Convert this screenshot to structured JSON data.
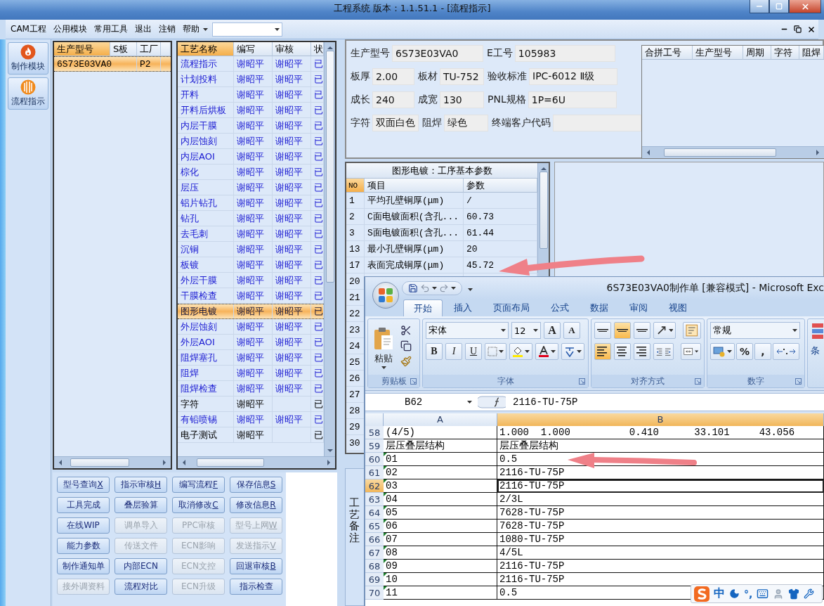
{
  "window": {
    "title": "工程系统   版本：1.1.51.1 - [流程指示]"
  },
  "menu": [
    "CAM工程",
    "公用模块",
    "常用工具",
    "退出",
    "注销",
    "帮助"
  ],
  "sidebar": [
    {
      "label": "制作模块",
      "kind": "flame"
    },
    {
      "label": "流程指示",
      "kind": "ball"
    }
  ],
  "model_table": {
    "columns": [
      {
        "label": "生产型号",
        "selected": true
      },
      {
        "label": "S板",
        "selected": false
      },
      {
        "label": "工厂",
        "selected": false
      }
    ],
    "rows": [
      {
        "model": "6S73E03VA0",
        "factory": "P2",
        "selected": true
      }
    ]
  },
  "process_table": {
    "columns": [
      {
        "label": "工艺名称",
        "selected": true
      },
      {
        "label": "编写",
        "selected": false
      },
      {
        "label": "审核",
        "selected": false
      },
      {
        "label": "状",
        "selected": false
      }
    ],
    "rows": [
      {
        "name": "流程指示",
        "writer": "谢昭平",
        "reviewer": "谢昭平",
        "status": "已",
        "reviewed": true,
        "selected": false
      },
      {
        "name": "计划投料",
        "writer": "谢昭平",
        "reviewer": "谢昭平",
        "status": "已",
        "reviewed": true,
        "selected": false
      },
      {
        "name": "开料",
        "writer": "谢昭平",
        "reviewer": "谢昭平",
        "status": "已",
        "reviewed": true,
        "selected": false
      },
      {
        "name": "开料后烘板",
        "writer": "谢昭平",
        "reviewer": "谢昭平",
        "status": "已",
        "reviewed": true,
        "selected": false
      },
      {
        "name": "内层干膜",
        "writer": "谢昭平",
        "reviewer": "谢昭平",
        "status": "已",
        "reviewed": true,
        "selected": false
      },
      {
        "name": "内层蚀刻",
        "writer": "谢昭平",
        "reviewer": "谢昭平",
        "status": "已",
        "reviewed": true,
        "selected": false
      },
      {
        "name": "内层AOI",
        "writer": "谢昭平",
        "reviewer": "谢昭平",
        "status": "已",
        "reviewed": true,
        "selected": false
      },
      {
        "name": "棕化",
        "writer": "谢昭平",
        "reviewer": "谢昭平",
        "status": "已",
        "reviewed": true,
        "selected": false
      },
      {
        "name": "层压",
        "writer": "谢昭平",
        "reviewer": "谢昭平",
        "status": "已",
        "reviewed": true,
        "selected": false
      },
      {
        "name": "铝片钻孔",
        "writer": "谢昭平",
        "reviewer": "谢昭平",
        "status": "已",
        "reviewed": true,
        "selected": false
      },
      {
        "name": "钻孔",
        "writer": "谢昭平",
        "reviewer": "谢昭平",
        "status": "已",
        "reviewed": true,
        "selected": false
      },
      {
        "name": "去毛刺",
        "writer": "谢昭平",
        "reviewer": "谢昭平",
        "status": "已",
        "reviewed": true,
        "selected": false
      },
      {
        "name": "沉铜",
        "writer": "谢昭平",
        "reviewer": "谢昭平",
        "status": "已",
        "reviewed": true,
        "selected": false
      },
      {
        "name": "板镀",
        "writer": "谢昭平",
        "reviewer": "谢昭平",
        "status": "已",
        "reviewed": true,
        "selected": false
      },
      {
        "name": "外层干膜",
        "writer": "谢昭平",
        "reviewer": "谢昭平",
        "status": "已",
        "reviewed": true,
        "selected": false
      },
      {
        "name": "干膜检查",
        "writer": "谢昭平",
        "reviewer": "谢昭平",
        "status": "已",
        "reviewed": true,
        "selected": false
      },
      {
        "name": "图形电镀",
        "writer": "谢昭平",
        "reviewer": "谢昭平",
        "status": "已",
        "reviewed": true,
        "selected": true
      },
      {
        "name": "外层蚀刻",
        "writer": "谢昭平",
        "reviewer": "谢昭平",
        "status": "已",
        "reviewed": true,
        "selected": false
      },
      {
        "name": "外层AOI",
        "writer": "谢昭平",
        "reviewer": "谢昭平",
        "status": "已",
        "reviewed": true,
        "selected": false
      },
      {
        "name": "阻焊塞孔",
        "writer": "谢昭平",
        "reviewer": "谢昭平",
        "status": "已",
        "reviewed": true,
        "selected": false
      },
      {
        "name": "阻焊",
        "writer": "谢昭平",
        "reviewer": "谢昭平",
        "status": "已",
        "reviewed": true,
        "selected": false
      },
      {
        "name": "阻焊检查",
        "writer": "谢昭平",
        "reviewer": "谢昭平",
        "status": "已",
        "reviewed": true,
        "selected": false
      },
      {
        "name": "字符",
        "writer": "谢昭平",
        "status": "已",
        "reviewed": false,
        "selected": false
      },
      {
        "name": "有铅喷锡",
        "writer": "谢昭平",
        "reviewer": "谢昭平",
        "status": "已",
        "reviewed": true,
        "selected": false
      },
      {
        "name": "电子测试",
        "writer": "谢昭平",
        "status": "已",
        "reviewed": false,
        "selected": false
      }
    ]
  },
  "buttons": [
    {
      "label": "型号查询",
      "hotkey": "X",
      "disabled": false
    },
    {
      "label": "指示审核",
      "hotkey": "H",
      "disabled": false
    },
    {
      "label": "编写流程",
      "hotkey": "F",
      "disabled": false
    },
    {
      "label": "保存信息",
      "hotkey": "S",
      "disabled": false
    },
    {
      "label": "工具完成",
      "disabled": false
    },
    {
      "label": "叠层验算",
      "disabled": false
    },
    {
      "label": "取消修改",
      "hotkey": "C",
      "disabled": false
    },
    {
      "label": "修改信息",
      "hotkey": "R",
      "disabled": false
    },
    {
      "label": "在线WIP",
      "disabled": false
    },
    {
      "label": "调单导入",
      "disabled": true
    },
    {
      "label": "PPC审核",
      "disabled": true
    },
    {
      "label": "型号上网",
      "hotkey": "W",
      "disabled": true
    },
    {
      "label": "能力参数",
      "disabled": false
    },
    {
      "label": "传送文件",
      "disabled": true
    },
    {
      "label": "ECN影响",
      "disabled": true
    },
    {
      "label": "发送指示",
      "hotkey": "V",
      "disabled": true
    },
    {
      "label": "制作通知单",
      "disabled": false
    },
    {
      "label": "内部ECN",
      "disabled": false
    },
    {
      "label": "ECN文控",
      "disabled": true
    },
    {
      "label": "回退审核",
      "hotkey": "B",
      "disabled": false
    },
    {
      "label": "接外调资料",
      "disabled": true
    },
    {
      "label": "流程对比",
      "disabled": false
    },
    {
      "label": "ECN升级",
      "disabled": true
    },
    {
      "label": "指示检查",
      "disabled": false
    }
  ],
  "info": [
    [
      {
        "label": "生产型号",
        "value": "6S73E03VA0"
      },
      {
        "label": "E工号",
        "value": "105983"
      }
    ],
    [
      {
        "label": "板厚",
        "value": "2.00"
      },
      {
        "label": "板材",
        "value": "TU-752"
      },
      {
        "label": "验收标准",
        "value": "IPC-6012 Ⅱ级"
      }
    ],
    [
      {
        "label": "成长",
        "value": "240"
      },
      {
        "label": "成宽",
        "value": "130"
      },
      {
        "label": "PNL规格",
        "value": "1P=6U"
      }
    ],
    [
      {
        "label": "字符",
        "value": "双面白色"
      },
      {
        "label": "阻焊",
        "value": "绿色"
      },
      {
        "label": "终端客户代码"
      }
    ]
  ],
  "merge_table": {
    "columns": [
      "合拼工号",
      "生产型号",
      "周期",
      "字符",
      "阻焊"
    ]
  },
  "params": {
    "title": "图形电镀：工序基本参数",
    "columns": [
      "NO",
      "项目",
      "参数"
    ],
    "rows": [
      {
        "no": "1",
        "item": "平均孔壁铜厚(μm)",
        "value": "/"
      },
      {
        "no": "2",
        "item": "C面电镀面积(含孔...",
        "value": "60.73"
      },
      {
        "no": "3",
        "item": "S面电镀面积(含孔...",
        "value": "61.44"
      },
      {
        "no": "13",
        "item": "最小孔壁铜厚(μm)",
        "value": "20"
      },
      {
        "no": "17",
        "item": "表面完成铜厚(μm)",
        "value": "45.72"
      },
      {
        "no": "20"
      },
      {
        "no": "21"
      },
      {
        "no": "22"
      },
      {
        "no": "23"
      },
      {
        "no": "24"
      },
      {
        "no": "25"
      },
      {
        "no": "26"
      },
      {
        "no": "27"
      },
      {
        "no": "28"
      },
      {
        "no": "29"
      },
      {
        "no": "30"
      }
    ]
  },
  "notes_label": "工艺备注",
  "excel": {
    "title": "6S73E03VA0制作单  [兼容模式] - Microsoft Exc",
    "tabs": [
      {
        "label": "开始",
        "selected": true
      },
      {
        "label": "插入",
        "selected": false
      },
      {
        "label": "页面布局",
        "selected": false
      },
      {
        "label": "公式",
        "selected": false
      },
      {
        "label": "数据",
        "selected": false
      },
      {
        "label": "审阅",
        "selected": false
      },
      {
        "label": "视图",
        "selected": false
      }
    ],
    "groups": [
      "剪贴板",
      "字体",
      "对齐方式",
      "数字"
    ],
    "paste": "粘贴",
    "font": "宋体",
    "font_size": "12",
    "size_buttons": [
      "A",
      "A"
    ],
    "style_buttons": [
      "B",
      "I",
      "U"
    ],
    "alignment": [
      {
        "kind": "top",
        "selected": false
      },
      {
        "kind": "middle",
        "selected": true
      },
      {
        "kind": "bottom",
        "selected": false
      },
      {
        "kind": "left",
        "selected": true
      },
      {
        "kind": "center",
        "selected": false
      },
      {
        "kind": "right",
        "selected": false
      }
    ],
    "number_format": "常规",
    "number_buttons": [
      "%",
      ","
    ],
    "next_group": "条",
    "name_box": "B62",
    "formula": "2116-TU-75P",
    "columns": [
      {
        "label": "A",
        "selected": false
      },
      {
        "label": "B",
        "selected": true
      }
    ],
    "rows": [
      {
        "no": "58",
        "a": "(4/5)",
        "b": "1.000  1.000          0.410      33.101     43.056",
        "flag": false,
        "selected": false
      },
      {
        "no": "59",
        "a": "层压叠层结构",
        "b": "层压叠层结构",
        "flag": false,
        "selected": false
      },
      {
        "no": "60",
        "a": "01",
        "b": "0.5",
        "flag": true,
        "selected": false
      },
      {
        "no": "61",
        "a": "02",
        "b": "2116-TU-75P",
        "flag": true,
        "selected": false
      },
      {
        "no": "62",
        "a": "03",
        "b": "2116-TU-75P",
        "flag": true,
        "selected": true
      },
      {
        "no": "63",
        "a": "04",
        "b": "2/3L",
        "flag": true,
        "selected": false
      },
      {
        "no": "64",
        "a": "05",
        "b": "7628-TU-75P",
        "flag": true,
        "selected": false
      },
      {
        "no": "65",
        "a": "06",
        "b": "7628-TU-75P",
        "flag": true,
        "selected": false
      },
      {
        "no": "66",
        "a": "07",
        "b": "1080-TU-75P",
        "flag": true,
        "selected": false
      },
      {
        "no": "67",
        "a": "08",
        "b": "4/5L",
        "flag": true,
        "selected": false
      },
      {
        "no": "68",
        "a": "09",
        "b": "2116-TU-75P",
        "flag": true,
        "selected": false
      },
      {
        "no": "69",
        "a": "10",
        "b": "2116-TU-75P",
        "flag": true,
        "selected": false
      },
      {
        "no": "70",
        "a": "11",
        "b": "0.5",
        "flag": true,
        "selected": false
      }
    ]
  },
  "ime": {
    "language": "中",
    "punctuation": "°,"
  }
}
